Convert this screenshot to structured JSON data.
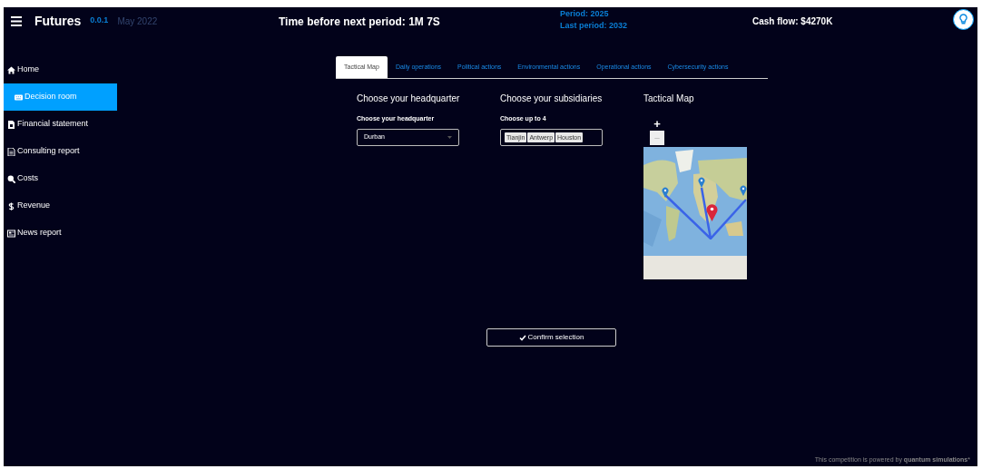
{
  "header": {
    "app_name": "Futures",
    "version": "0.0.1",
    "date": "May 2022",
    "timer": "Time before next period: 1M 7S",
    "period": "Period: 2025",
    "last_period": "Last period: 2032",
    "cash_flow": "Cash flow: $4270K"
  },
  "sidebar": {
    "items": [
      {
        "label": "Home",
        "kind": "home",
        "selected": false
      },
      {
        "label": "Decision room",
        "kind": "keyboard",
        "selected": true
      },
      {
        "label": "Financial statement",
        "kind": "invoice",
        "selected": false
      },
      {
        "label": "Consulting report",
        "kind": "report",
        "selected": false
      },
      {
        "label": "Costs",
        "kind": "search",
        "selected": false
      },
      {
        "label": "Revenue",
        "kind": "money",
        "selected": false
      },
      {
        "label": "News report",
        "kind": "news",
        "selected": false
      }
    ]
  },
  "tabs": [
    {
      "label": "Tactical Map",
      "selected": true
    },
    {
      "label": "Daily operations",
      "selected": false
    },
    {
      "label": "Political actions",
      "selected": false
    },
    {
      "label": "Environmental actions",
      "selected": false
    },
    {
      "label": "Operational actions",
      "selected": false
    },
    {
      "label": "Cybersecurity actions",
      "selected": false
    }
  ],
  "headquarter": {
    "heading": "Choose your headquarter",
    "label": "Choose your headquarter",
    "value": "Durban"
  },
  "subsidiaries": {
    "heading": "Choose your subsidiaries",
    "label": "Choose up to 4",
    "values": [
      "Tianjin",
      "Antwerp",
      "Houston"
    ]
  },
  "map": {
    "heading": "Tactical Map",
    "zoom_in": "+",
    "zoom_out": "−"
  },
  "confirm_button": "Confirm selection",
  "footer": "This competition is powered by **quantum simulations***"
}
